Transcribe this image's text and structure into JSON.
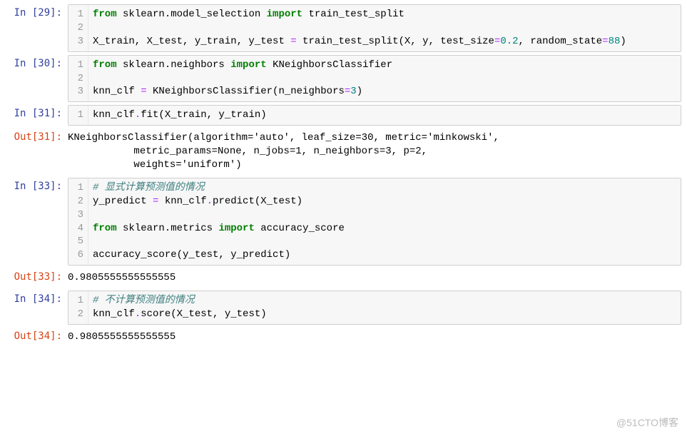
{
  "watermark": "@51CTO博客",
  "cells": [
    {
      "type": "in",
      "prompt": "In [29]:",
      "lineNumbers": [
        "1",
        "2",
        "3"
      ],
      "code": [
        [
          {
            "t": "from",
            "c": "tok-kw"
          },
          {
            "t": " sklearn.model_selection "
          },
          {
            "t": "import",
            "c": "tok-kw"
          },
          {
            "t": " train_test_split"
          }
        ],
        [],
        [
          {
            "t": "X_train, X_test, y_train, y_test "
          },
          {
            "t": "=",
            "c": "tok-op"
          },
          {
            "t": " train_test_split(X, y, test_size"
          },
          {
            "t": "=",
            "c": "tok-op"
          },
          {
            "t": "0.2",
            "c": "tok-num"
          },
          {
            "t": ", random_state"
          },
          {
            "t": "=",
            "c": "tok-op"
          },
          {
            "t": "88",
            "c": "tok-num"
          },
          {
            "t": ")"
          }
        ]
      ]
    },
    {
      "type": "in",
      "prompt": "In [30]:",
      "lineNumbers": [
        "1",
        "2",
        "3"
      ],
      "code": [
        [
          {
            "t": "from",
            "c": "tok-kw"
          },
          {
            "t": " sklearn.neighbors "
          },
          {
            "t": "import",
            "c": "tok-kw"
          },
          {
            "t": " KNeighborsClassifier"
          }
        ],
        [],
        [
          {
            "t": "knn_clf "
          },
          {
            "t": "=",
            "c": "tok-op"
          },
          {
            "t": " KNeighborsClassifier(n_neighbors"
          },
          {
            "t": "=",
            "c": "tok-op"
          },
          {
            "t": "3",
            "c": "tok-num"
          },
          {
            "t": ")"
          }
        ]
      ]
    },
    {
      "type": "in",
      "prompt": "In [31]:",
      "lineNumbers": [
        "1"
      ],
      "code": [
        [
          {
            "t": "knn_clf"
          },
          {
            "t": ".",
            "c": "tok-op"
          },
          {
            "t": "fit(X_train, y_train)"
          }
        ]
      ]
    },
    {
      "type": "out",
      "prompt": "Out[31]:",
      "output": "KNeighborsClassifier(algorithm='auto', leaf_size=30, metric='minkowski',\n           metric_params=None, n_jobs=1, n_neighbors=3, p=2,\n           weights='uniform')"
    },
    {
      "type": "in",
      "prompt": "In [33]:",
      "lineNumbers": [
        "1",
        "2",
        "3",
        "4",
        "5",
        "6"
      ],
      "code": [
        [
          {
            "t": "# 显式计算预测值的情况",
            "c": "tok-cm"
          }
        ],
        [
          {
            "t": "y_predict "
          },
          {
            "t": "=",
            "c": "tok-op"
          },
          {
            "t": " knn_clf"
          },
          {
            "t": ".",
            "c": "tok-op"
          },
          {
            "t": "predict(X_test)"
          }
        ],
        [],
        [
          {
            "t": "from",
            "c": "tok-kw"
          },
          {
            "t": " sklearn.metrics "
          },
          {
            "t": "import",
            "c": "tok-kw"
          },
          {
            "t": " accuracy_score"
          }
        ],
        [],
        [
          {
            "t": "accuracy_score(y_test, y_predict)"
          }
        ]
      ]
    },
    {
      "type": "out",
      "prompt": "Out[33]:",
      "output": "0.9805555555555555"
    },
    {
      "type": "in",
      "prompt": "In [34]:",
      "lineNumbers": [
        "1",
        "2"
      ],
      "code": [
        [
          {
            "t": "# 不计算预测值的情况",
            "c": "tok-cm"
          }
        ],
        [
          {
            "t": "knn_clf"
          },
          {
            "t": ".",
            "c": "tok-op"
          },
          {
            "t": "score(X_test, y_test)"
          }
        ]
      ]
    },
    {
      "type": "out",
      "prompt": "Out[34]:",
      "output": "0.9805555555555555"
    }
  ]
}
